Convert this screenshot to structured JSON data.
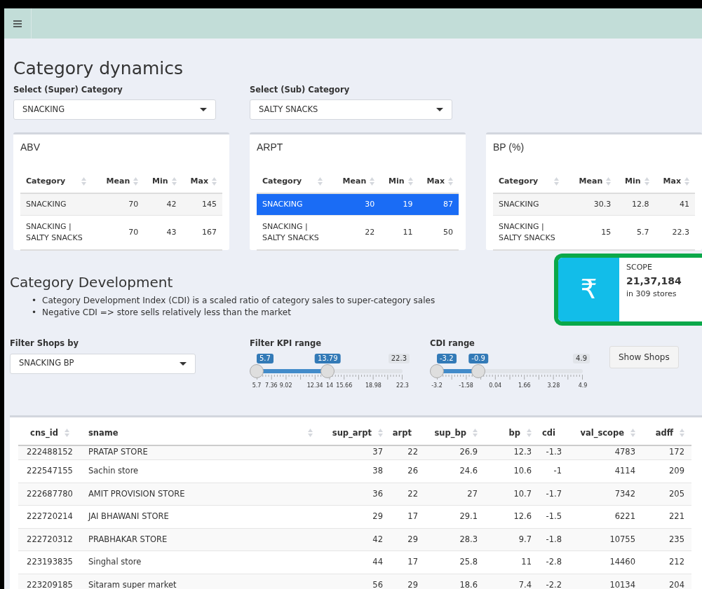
{
  "title": "Category dynamics",
  "selects": [
    {
      "label": "Select (Super) Category",
      "value": "SNACKING"
    },
    {
      "label": "Select (Sub) Category",
      "value": "SALTY SNACKS"
    }
  ],
  "summary_tables": [
    {
      "title": "ABV",
      "columns": [
        "Category",
        "Mean",
        "Min",
        "Max"
      ],
      "rows": [
        {
          "cells": [
            "SNACKING",
            "70",
            "42",
            "145"
          ],
          "selected": false
        },
        {
          "cells": [
            "SNACKING | SALTY SNACKS",
            "70",
            "43",
            "167"
          ],
          "selected": false
        }
      ]
    },
    {
      "title": "ARPT",
      "columns": [
        "Category",
        "Mean",
        "Min",
        "Max"
      ],
      "rows": [
        {
          "cells": [
            "SNACKING",
            "30",
            "19",
            "87"
          ],
          "selected": true
        },
        {
          "cells": [
            "SNACKING | SALTY SNACKS",
            "22",
            "11",
            "50"
          ],
          "selected": false
        }
      ]
    },
    {
      "title": "BP (%)",
      "columns": [
        "Category",
        "Mean",
        "Min",
        "Max"
      ],
      "rows": [
        {
          "cells": [
            "SNACKING",
            "30.3",
            "12.8",
            "41"
          ],
          "selected": false
        },
        {
          "cells": [
            "SNACKING | SALTY SNACKS",
            "15",
            "5.7",
            "22.3"
          ],
          "selected": false
        }
      ]
    }
  ],
  "development": {
    "title": "Category Development",
    "bullets": [
      {
        "marker": "•",
        "text": "Category Development Index (CDI) is a scaled ratio of category sales to super-category sales"
      },
      {
        "marker": "•",
        "text": "Negative CDI => store sells relatively less than the market"
      }
    ]
  },
  "scope": {
    "icon": "₹",
    "label": "SCOPE",
    "value": "21,37,184",
    "detail": "in 309 stores"
  },
  "shop_filter": {
    "label": "Filter Shops by",
    "value": "SNACKING BP"
  },
  "sliders": [
    {
      "label": "Filter KPI range",
      "max": "22.3",
      "from": {
        "label": "5.7",
        "level": 0
      },
      "to": {
        "label": "13.79",
        "level": 0.487
      },
      "ticks": [
        "5.7",
        "7.36",
        "9.02",
        "12.34",
        "14",
        "15.66",
        "18.98",
        "22.3"
      ]
    },
    {
      "label": "CDI range",
      "max": "4.9",
      "from": {
        "label": "-3.2",
        "level": 0
      },
      "to": {
        "label": "-0.9",
        "level": 0.284
      },
      "ticks": [
        "-3.2",
        "-1.58",
        "0.04",
        "1.66",
        "3.28",
        "4.9"
      ]
    }
  ],
  "show_button": "Show Shops",
  "shops_table": {
    "columns": [
      "cns_id",
      "sname",
      "sup_arpt",
      "arpt",
      "sup_bp",
      "bp",
      "cdi",
      "val_scope",
      "adff"
    ],
    "rows": [
      [
        "222488152",
        "PRATAP STORE",
        "37",
        "22",
        "26.9",
        "12.3",
        "-1.3",
        "4783",
        "172"
      ],
      [
        "222547155",
        "Sachin store",
        "38",
        "26",
        "24.6",
        "10.6",
        "-1",
        "4114",
        "209"
      ],
      [
        "222687780",
        "AMIT PROVISION STORE",
        "36",
        "22",
        "27",
        "10.7",
        "-1.7",
        "7342",
        "205"
      ],
      [
        "222720214",
        "JAI BHAWANI STORE",
        "29",
        "17",
        "29.1",
        "12.6",
        "-1.5",
        "6221",
        "221"
      ],
      [
        "222720312",
        "PRABHAKAR STORE",
        "42",
        "29",
        "28.3",
        "9.7",
        "-1.8",
        "10755",
        "235"
      ],
      [
        "223193835",
        "Singhal store",
        "44",
        "17",
        "25.8",
        "11",
        "-2.8",
        "14460",
        "212"
      ],
      [
        "223209185",
        "Sitaram super market",
        "56",
        "29",
        "18.6",
        "7.4",
        "-2.2",
        "10134",
        "204"
      ]
    ]
  }
}
